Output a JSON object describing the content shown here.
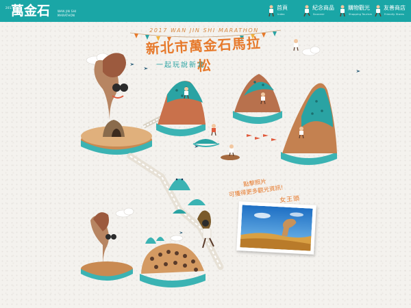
{
  "header": {
    "logo": {
      "top_text": "2017",
      "big_text": "萬金石",
      "sub_line1": "WAN JIN SHI",
      "sub_line2": "MARATHON"
    },
    "nav": [
      {
        "label": "首頁",
        "en": "Index",
        "icon": "runner-icon"
      },
      {
        "label": "紀念商品",
        "en": "Souvenir",
        "icon": "runner-icon"
      },
      {
        "label": "購物觀光",
        "en": "Shopping Tourism",
        "icon": "runner-icon"
      },
      {
        "label": "友善商店",
        "en": "Friendly Stores",
        "icon": "runner-icon"
      }
    ]
  },
  "hero": {
    "event_en": "2017 WAN JIN SHI MARATHON",
    "title_zh": "新北市萬金石馬拉松",
    "subtitle_zh": "一起玩說新北"
  },
  "callout": {
    "line1": "點擊照片",
    "line2": "可獲得更多觀光資訊!",
    "place": "女王頭"
  },
  "colors": {
    "header": "#1aa6a6",
    "accent_orange": "#e6792b",
    "teal": "#2aa3a3",
    "paper": "#f4f2ee"
  }
}
